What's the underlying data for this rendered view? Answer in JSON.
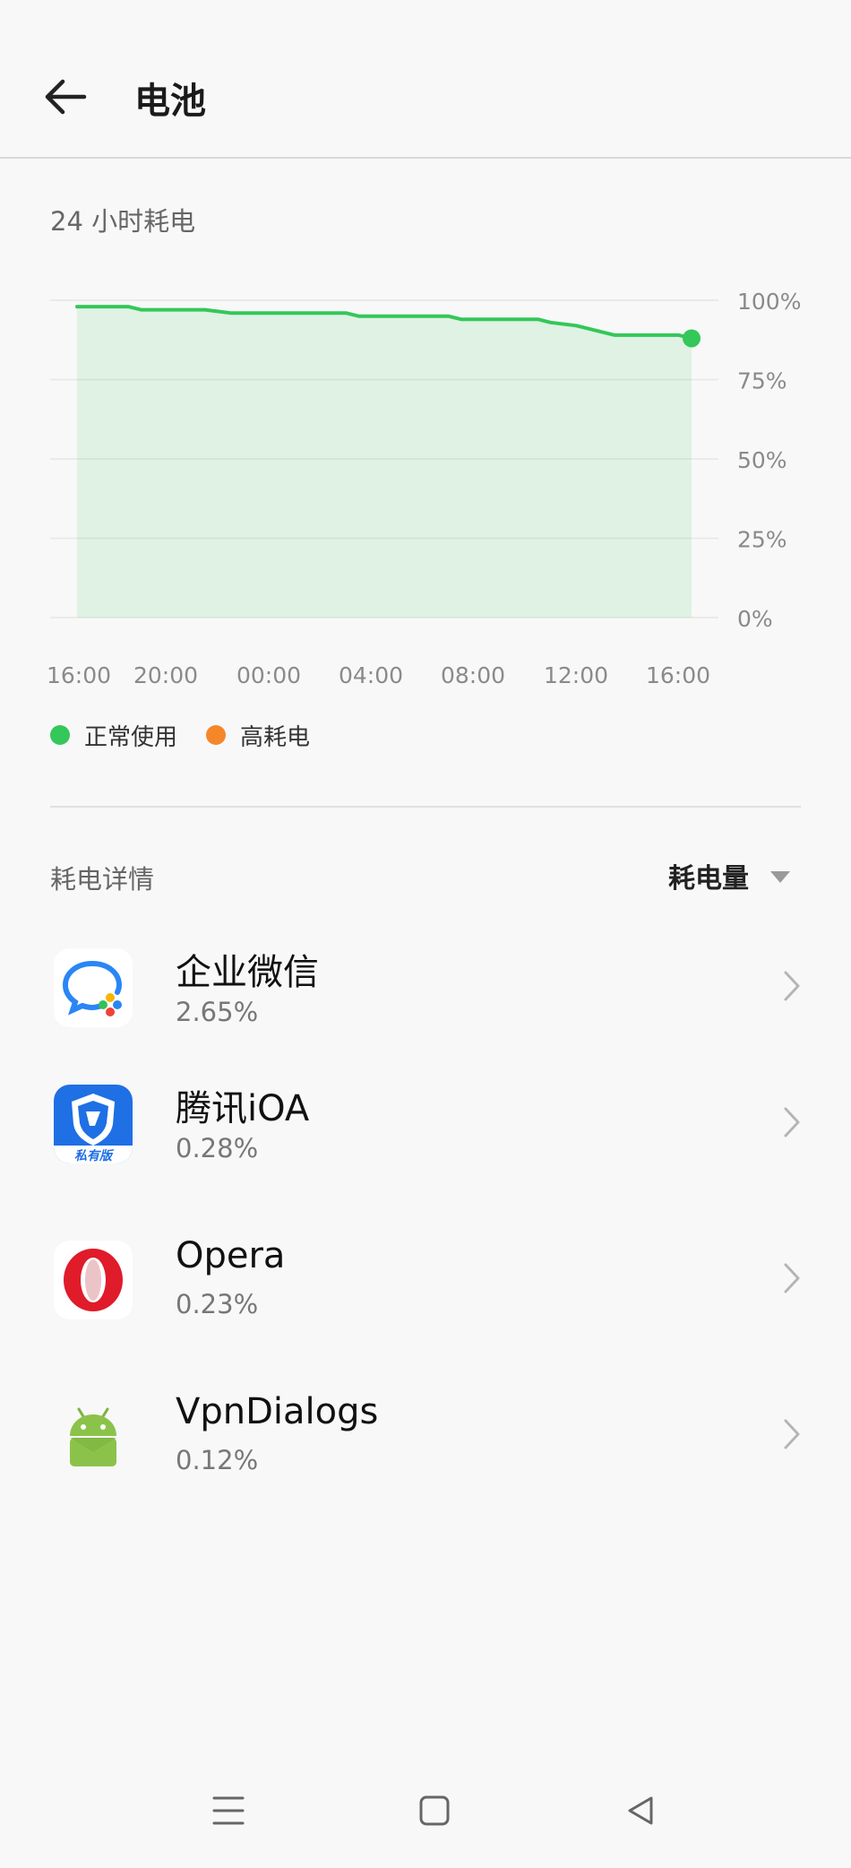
{
  "header": {
    "title": "电池",
    "back_icon": "arrow-left-icon"
  },
  "usage_section": {
    "title": "24 小时耗电"
  },
  "legend": [
    {
      "label": "正常使用",
      "color": "#34c759"
    },
    {
      "label": "高耗电",
      "color": "#f5872a"
    }
  ],
  "details": {
    "title": "耗电详情",
    "sort": {
      "selected": "耗电量",
      "icon": "caret-down-icon"
    }
  },
  "apps": [
    {
      "name": "企业微信",
      "percent": "2.65%",
      "icon": "wecom-icon"
    },
    {
      "name": "腾讯iOA",
      "percent": "0.28%",
      "icon": "tencent-ioa-icon",
      "icon_caption": "私有版"
    },
    {
      "name": "Opera",
      "percent": "0.23%",
      "icon": "opera-icon"
    },
    {
      "name": "VpnDialogs",
      "percent": "0.12%",
      "icon": "android-icon"
    }
  ],
  "navbar": {
    "menu_icon": "menu-icon",
    "home_icon": "home-icon",
    "back_icon": "back-triangle-icon"
  },
  "chart_data": {
    "type": "area",
    "title": "",
    "x_ticks": [
      "16:00",
      "20:00",
      "00:00",
      "04:00",
      "08:00",
      "12:00",
      "16:00"
    ],
    "y_ticks": [
      "100%",
      "75%",
      "50%",
      "25%",
      "0%"
    ],
    "ylim": [
      0,
      100
    ],
    "xlim_hours": [
      0,
      24
    ],
    "grid": true,
    "legend_position": "bottom-left",
    "series": [
      {
        "name": "正常使用",
        "color": "#34c759",
        "x_hours": [
          0,
          2,
          2.5,
          5,
          6,
          10.5,
          11,
          14.5,
          15,
          18,
          18.5,
          19.5,
          21,
          23.5,
          24
        ],
        "values": [
          98,
          98,
          97,
          97,
          96,
          96,
          95,
          95,
          94,
          94,
          93,
          92,
          89,
          89,
          88
        ]
      }
    ]
  }
}
